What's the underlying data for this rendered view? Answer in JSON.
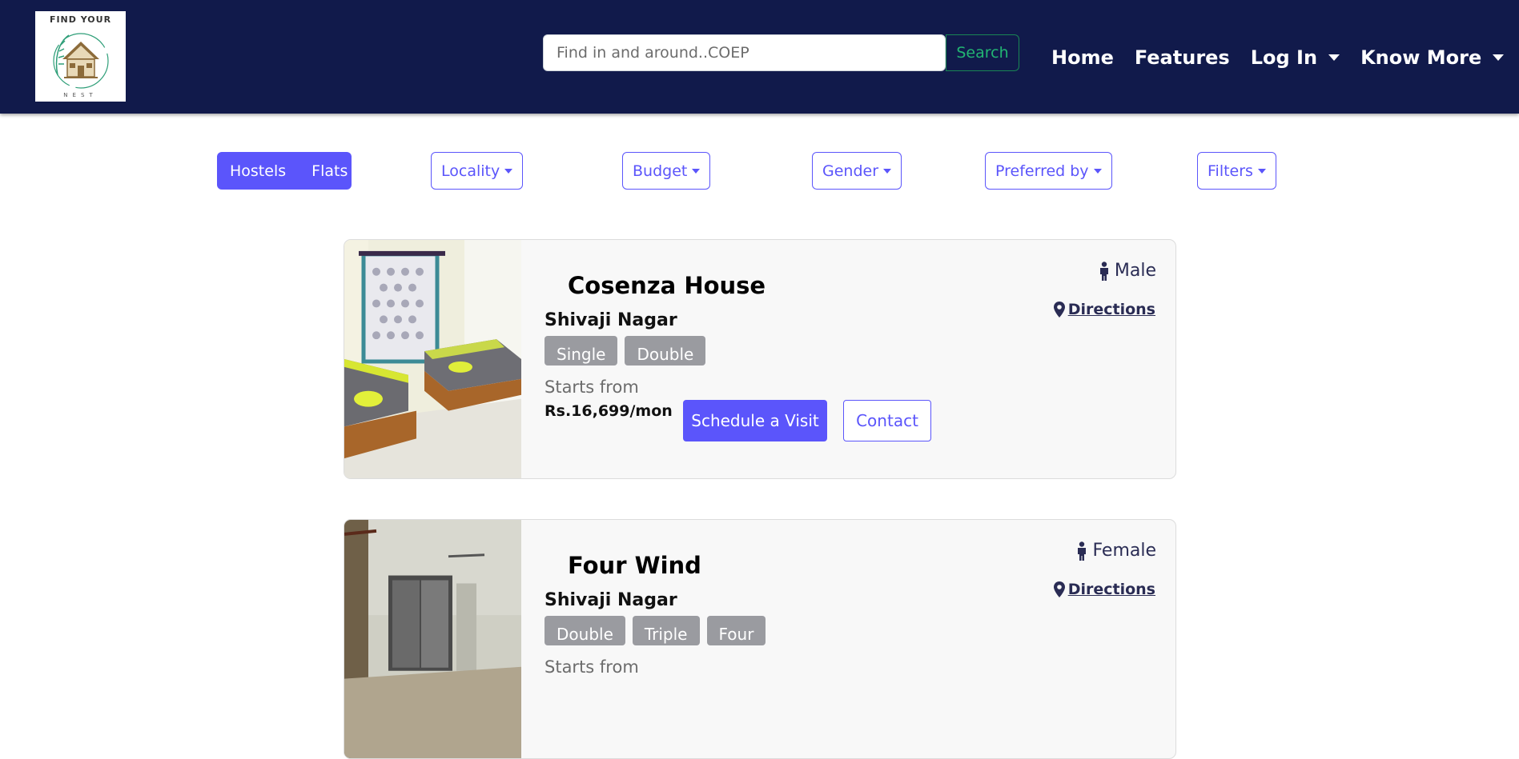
{
  "brand": {
    "logo_top": "FIND YOUR",
    "logo_bottom": "NEST"
  },
  "search": {
    "placeholder": "Find in and around..COEP",
    "button_label": "Search"
  },
  "nav": {
    "home": "Home",
    "features": "Features",
    "login": "Log In",
    "know_more": "Know More"
  },
  "filters": {
    "toggle": [
      "Hostels",
      "Flats"
    ],
    "locality": "Locality",
    "budget": "Budget",
    "gender": "Gender",
    "preferred_by": "Preferred by",
    "filters": "Filters"
  },
  "listings": [
    {
      "title": "Cosenza House",
      "locality": "Shivaji Nagar",
      "room_types": [
        "Single",
        "Double"
      ],
      "starts_from_label": "Starts from",
      "price": "Rs.16,699/mon",
      "gender": "Male",
      "directions_label": "Directions",
      "schedule_label": "Schedule a Visit",
      "contact_label": "Contact"
    },
    {
      "title": "Four Wind",
      "locality": "Shivaji Nagar",
      "room_types": [
        "Double",
        "Triple",
        "Four"
      ],
      "starts_from_label": "Starts from",
      "gender": "Female",
      "directions_label": "Directions"
    }
  ],
  "colors": {
    "navbar": "#111a4b",
    "accent": "#5b55fb",
    "search_button": "#198754",
    "tag": "#9a9ba0"
  }
}
